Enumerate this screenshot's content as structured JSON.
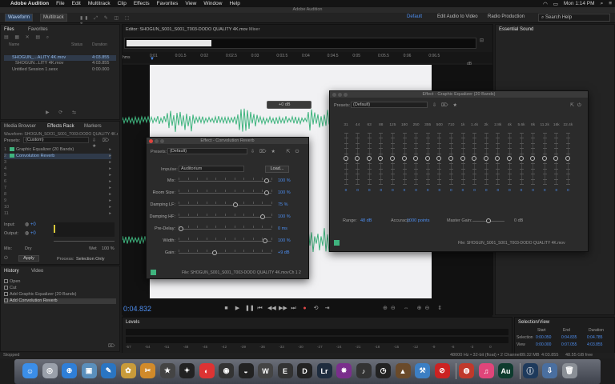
{
  "menubar": {
    "apple": "",
    "app": "Adobe Audition",
    "items": [
      "File",
      "Edit",
      "Multitrack",
      "Clip",
      "Effects",
      "Favorites",
      "View",
      "Window",
      "Help"
    ],
    "right": [
      "Mon 1:14 PM"
    ]
  },
  "app_title": "Adobe Audition",
  "toolbar": {
    "waveform": "Waveform",
    "multitrack": "Multitrack",
    "workspace": "Default",
    "edit_video": "Edit Audio to Video",
    "radio": "Radio Production",
    "search_placeholder": "Search Help"
  },
  "files": {
    "tab1": "Files",
    "tab2": "Favorites",
    "cols": [
      "Name",
      "Status",
      "Duration"
    ],
    "items": [
      {
        "name": "SHOGUN_...ALITY 4K.mov",
        "duration": "4:03.855",
        "sel": true
      },
      {
        "name": "SHOGUN...LITY 4K.mov",
        "duration": "4:03.855"
      },
      {
        "name": "Untitled Session 1.sesx",
        "duration": "0:00.000"
      }
    ]
  },
  "media": {
    "tab1": "Media Browser",
    "tab2": "Effects Rack",
    "tab3": "Markers",
    "tabnote": "Effects Rack",
    "presets_label": "Presets:",
    "preset": "(Custom)",
    "clip_label": "Waveform: SHOGUN_SOO1_S001_T003-DODO QUALITY 4K.mov",
    "fx": [
      "Graphic Equalizer (20 Bands)",
      "Convolution Reverb",
      "",
      "",
      "",
      "",
      "",
      "",
      "",
      "",
      ""
    ]
  },
  "mix": {
    "input": "Input:",
    "output": "Output:",
    "db": "+0",
    "mix_label": "Mix:",
    "dry": "Dry",
    "wet": "Wet",
    "wet_pct": "100 %",
    "apply": "Apply",
    "process_label": "Process:",
    "process_value": "Selection Only"
  },
  "history": {
    "tab1": "History",
    "tab2": "Video",
    "items": [
      "Open",
      "Cut",
      "Add Graphic Equalizer (20 Bands)",
      "Add Convolution Reverb"
    ]
  },
  "editor": {
    "title": "Editor: SHOGUN_S001_S001_T003-DODO QUALITY 4K.mov",
    "mixer": "Mixer",
    "ruler": [
      "0:01",
      "0:01.5",
      "0:02",
      "0:02.5",
      "0:03",
      "0:03.5",
      "0:04",
      "0:04.5",
      "0:05",
      "0:05.5",
      "0:06",
      "0:06.5"
    ],
    "hms": "hms",
    "db_label": "dB",
    "db_ticks": [
      "-3",
      "-6",
      "-12",
      "-18",
      "-24"
    ],
    "hud_value": "+0 dB"
  },
  "timecode": "0:04.832",
  "transport": [
    "■",
    "▶",
    "❚❚",
    "⏮",
    "◀◀",
    "▶▶",
    "⏭",
    "●",
    "⟲",
    "⇥"
  ],
  "levels": {
    "title": "Levels",
    "ticks": [
      "-57",
      "-54",
      "-51",
      "-48",
      "-45",
      "-42",
      "-39",
      "-36",
      "-33",
      "-30",
      "-27",
      "-24",
      "-21",
      "-18",
      "-15",
      "-12",
      "-9",
      "-6",
      "-3",
      "0"
    ]
  },
  "selview": {
    "title": "Selection/View",
    "cols": [
      "Start",
      "End",
      "Duration"
    ],
    "rows": [
      {
        "name": "Selection",
        "start": "0:00.050",
        "end": "0:04.835",
        "duration": "0:04.785"
      },
      {
        "name": "View",
        "start": "0:00.000",
        "end": "0:07.055",
        "duration": "4:03.855"
      }
    ]
  },
  "status": {
    "left": "Stopped",
    "right": [
      "48000 Hz • 32-bit (float) • 2 Channel",
      "89.32 MB",
      "4:03.855",
      "48.55 GB free"
    ]
  },
  "reverb": {
    "title": "Effect - Convolution Reverb",
    "presets_label": "Presets:",
    "preset": "(Default)",
    "impulse_label": "Impulse:",
    "impulse": "Auditorium",
    "load": "Load...",
    "params": [
      {
        "label": "Mix:",
        "value": "100 %"
      },
      {
        "label": "Room Size:",
        "value": "100 %"
      },
      {
        "label": "Damping LF:",
        "value": "75 %"
      },
      {
        "label": "Damping HF:",
        "value": "100 %"
      },
      {
        "label": "Pre-Delay:",
        "value": "0 ms"
      },
      {
        "label": "Width:",
        "value": "100 %"
      },
      {
        "label": "Gain:",
        "value": "+9 dB"
      }
    ],
    "param_levels": [
      0.97,
      0.97,
      0.62,
      0.93,
      0.0,
      0.95,
      0.38
    ],
    "footer": "File: SHOGUN_S001_S001_T003-DODO QUALITY 4K.mov",
    "channels_label": "Ch 1 2"
  },
  "geq": {
    "title": "Effect - Graphic Equalizer (20 Bands)",
    "presets_label": "Presets:",
    "preset": "(Default)",
    "bands": [
      "31",
      "44",
      "63",
      "88",
      "125",
      "180",
      "250",
      "355",
      "500",
      "710",
      "1k",
      "1.4k",
      "2k",
      "2.8k",
      "4k",
      "5.6k",
      "8k",
      "11.2k",
      "16k",
      "22.4k"
    ],
    "scale": [
      "+20",
      "+16",
      "+12",
      "+8",
      "+4",
      "0",
      "-4",
      "-8",
      "-12",
      "-16",
      "-20"
    ],
    "range_label": "Range:",
    "range": "48 dB",
    "accuracy_label": "Accuracy:",
    "accuracy": "1000 points",
    "master_label": "Master Gain:",
    "master": "0 dB",
    "footer": "File: SHOGUN_S001_S001_T003-DODO QUALITY 4K.mov"
  },
  "dock": [
    {
      "name": "finder-icon",
      "color": "#3b8ee8",
      "glyph": "☺"
    },
    {
      "name": "launchpad-icon",
      "color": "#9aa0aa",
      "glyph": "◎"
    },
    {
      "name": "safari-icon",
      "color": "#2f7fd8",
      "glyph": "⊕"
    },
    {
      "name": "preview-icon",
      "color": "#5a8fbc",
      "glyph": "▣"
    },
    {
      "name": "photos-icon",
      "color": "#2a75c2",
      "glyph": "✎"
    },
    {
      "name": "notes-icon",
      "color": "#c89b3a",
      "glyph": "✿"
    },
    {
      "name": "claquette-icon",
      "color": "#d18a2a",
      "glyph": "✂"
    },
    {
      "name": "imovie-icon",
      "color": "#444",
      "glyph": "★"
    },
    {
      "name": "finalcut-icon",
      "color": "#222",
      "glyph": "✦"
    },
    {
      "name": "speedgrade-icon",
      "color": "#d33",
      "glyph": "◐"
    },
    {
      "name": "resolve-icon",
      "color": "#333",
      "glyph": "◉"
    },
    {
      "name": "photoshop-icon",
      "color": "#222",
      "glyph": "◒"
    },
    {
      "name": "wordpress-icon",
      "color": "#444",
      "glyph": "W"
    },
    {
      "name": "epub-icon",
      "color": "#333",
      "glyph": "E"
    },
    {
      "name": "dreamweaver-icon",
      "color": "#222",
      "glyph": "D"
    },
    {
      "name": "lightroom-icon",
      "color": "#1e2c3e",
      "glyph": "Lr"
    },
    {
      "name": "davinci-icon",
      "color": "#7a2e8c",
      "glyph": "✸"
    },
    {
      "name": "piano-icon",
      "color": "#333",
      "glyph": "♪"
    },
    {
      "name": "clock-icon",
      "color": "#222",
      "glyph": "◷"
    },
    {
      "name": "camera-icon",
      "color": "#6a4a2a",
      "glyph": "▲"
    },
    {
      "name": "xcode-icon",
      "color": "#3c7fc4",
      "glyph": "⚒"
    },
    {
      "name": "block-icon",
      "color": "#c22",
      "glyph": "⊘"
    },
    {
      "name": "divider",
      "color": "transparent",
      "glyph": ""
    },
    {
      "name": "launcher-icon",
      "color": "#c0392b",
      "glyph": "◍"
    },
    {
      "name": "itunes-icon",
      "color": "#e0457a",
      "glyph": "♫"
    },
    {
      "name": "audition-icon",
      "color": "#0d3b2e",
      "glyph": "Au"
    },
    {
      "name": "divider",
      "color": "transparent",
      "glyph": ""
    },
    {
      "name": "system-prefs-icon",
      "color": "#1e3a5c",
      "glyph": "ⓘ"
    },
    {
      "name": "downloads-icon",
      "color": "#4a6fa0",
      "glyph": "⇩"
    },
    {
      "name": "trash-icon",
      "color": "#8a8f96",
      "glyph": "🗑"
    }
  ]
}
